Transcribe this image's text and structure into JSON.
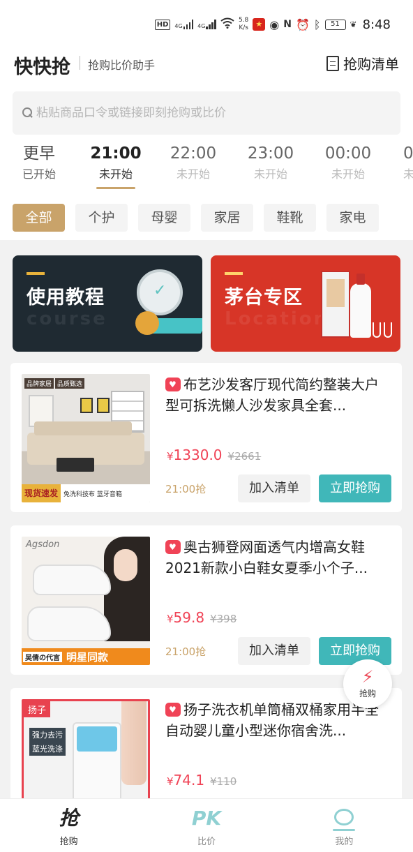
{
  "status_bar": {
    "hd": "HD",
    "sig1": "4G",
    "sig2": "4G",
    "net_speed_value": "5.8",
    "net_speed_unit": "K/s",
    "battery": "51",
    "time": "8:48"
  },
  "header": {
    "title": "快快抢",
    "subtitle": "抢购比价助手",
    "list_label": "抢购清单"
  },
  "search": {
    "placeholder": "粘贴商品口令或链接即刻抢购或比价"
  },
  "time_tabs": [
    {
      "time": "更早",
      "status": "已开始"
    },
    {
      "time": "21:00",
      "status": "未开始"
    },
    {
      "time": "22:00",
      "status": "未开始"
    },
    {
      "time": "23:00",
      "status": "未开始"
    },
    {
      "time": "00:00",
      "status": "未开始"
    },
    {
      "time": "0",
      "status": "未"
    }
  ],
  "categories": [
    "全部",
    "个护",
    "母婴",
    "家居",
    "鞋靴",
    "家电"
  ],
  "banners": {
    "course": {
      "title": "使用教程",
      "ghost": "course"
    },
    "moutai": {
      "title": "茅台专区",
      "ghost": "Location"
    }
  },
  "products": [
    {
      "title": "布艺沙发客厅现代简约整装大户型可拆洗懒人沙发家具全套...",
      "price_symbol": "¥",
      "price": "1330.0",
      "original_price": "¥2661",
      "grab_time": "21:00抢",
      "add_label": "加入清单",
      "buy_label": "立即抢购",
      "image": {
        "tag1": "品牌家居",
        "tag2": "品质甄选",
        "badge": "现货速发",
        "strip": "免洗科技布 蓝牙音箱"
      }
    },
    {
      "title": "奥古狮登网面透气内增高女鞋2021新款小白鞋女夏季小个子...",
      "price_symbol": "¥",
      "price": "59.8",
      "original_price": "¥398",
      "grab_time": "21:00抢",
      "add_label": "加入清单",
      "buy_label": "立即抢购",
      "image": {
        "brand": "Agsdon",
        "badge": "吴倩の代言",
        "strip": "明星同款"
      }
    },
    {
      "title": "扬子洗衣机单筒桶双桶家用半全自动婴儿童小型迷你宿舍洗...",
      "price_symbol": "¥",
      "price": "74.1",
      "original_price": "¥110",
      "image": {
        "brand": "扬子",
        "line1": "强力去污",
        "line2": "蓝光洗涤"
      }
    }
  ],
  "float_button": {
    "label": "抢购"
  },
  "bottom_nav": [
    {
      "icon": "抢",
      "label": "抢购"
    },
    {
      "icon": "PK",
      "label": "比价"
    },
    {
      "icon": "",
      "label": "我的"
    }
  ],
  "colors": {
    "accent_gold": "#c9a36a",
    "teal": "#40b7b9",
    "price_red": "#f04356",
    "moutai_red": "#d73527",
    "course_dark": "#1f2a32"
  }
}
